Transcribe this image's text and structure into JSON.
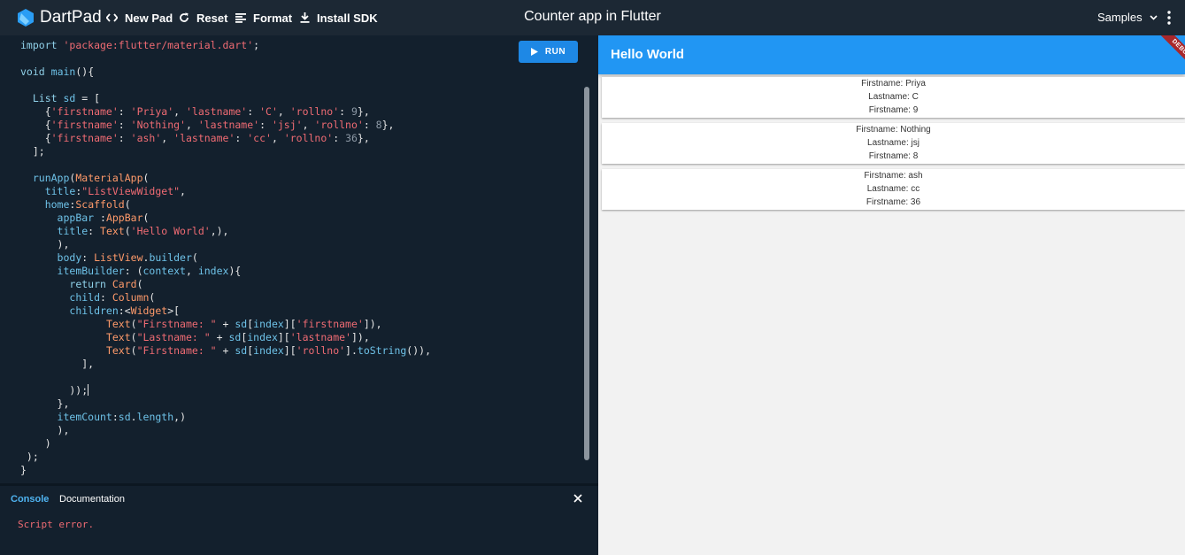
{
  "topbar": {
    "brand": "DartPad",
    "new_pad": "New Pad",
    "reset": "Reset",
    "format": "Format",
    "install_sdk": "Install SDK",
    "title": "Counter app in Flutter",
    "samples": "Samples"
  },
  "editor": {
    "run_label": "RUN",
    "code": [
      "import 'package:flutter/material.dart';",
      "",
      "void main(){",
      "",
      "  List sd = [",
      "    {'firstname': 'Priya', 'lastname': 'C', 'rollno': 9},",
      "    {'firstname': 'Nothing', 'lastname': 'jsj', 'rollno': 8},",
      "    {'firstname': 'ash', 'lastname': 'cc', 'rollno': 36},",
      "  ];",
      "",
      "  runApp(MaterialApp(",
      "    title:\"ListViewWidget\",",
      "    home:Scaffold(",
      "      appBar :AppBar(",
      "      title: Text('Hello World',),",
      "      ),",
      "      body: ListView.builder(",
      "      itemBuilder: (context, index){",
      "        return Card(",
      "        child: Column(",
      "        children:<Widget>[",
      "              Text(\"Firstname: \" + sd[index]['firstname']),",
      "              Text(\"Lastname: \" + sd[index]['lastname']),",
      "              Text(\"Firstname: \" + sd[index]['rollno'].toString()),",
      "          ],",
      "",
      "        ));",
      "      },",
      "      itemCount:sd.length,)",
      "      ),",
      "    )",
      " );",
      "}"
    ]
  },
  "console": {
    "tab_console": "Console",
    "tab_documentation": "Documentation",
    "output": "Script error."
  },
  "preview": {
    "appbar_title": "Hello World",
    "debug_label": "DEBUG",
    "cards": [
      {
        "line1": "Firstname: Priya",
        "line2": "Lastname: C",
        "line3": "Firstname: 9"
      },
      {
        "line1": "Firstname: Nothing",
        "line2": "Lastname: jsj",
        "line3": "Firstname: 8"
      },
      {
        "line1": "Firstname: ash",
        "line2": "Lastname: cc",
        "line3": "Firstname: 36"
      }
    ]
  },
  "colors": {
    "accent": "#1e88e5",
    "appbar": "#2196f3",
    "editor_bg": "#13202d",
    "error": "#ef6b73"
  },
  "icons": [
    "dart-logo-icon",
    "code-icon",
    "refresh-icon",
    "format-icon",
    "download-icon",
    "chevron-down-icon",
    "more-vert-icon",
    "play-icon",
    "close-icon"
  ]
}
